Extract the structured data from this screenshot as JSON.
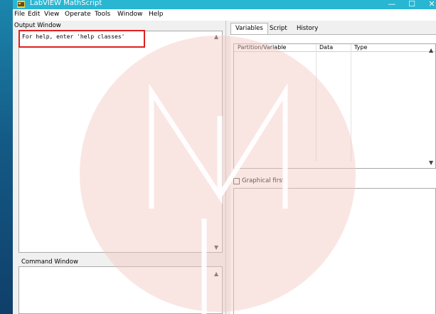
{
  "window": {
    "title": "LabVIEW MathScript"
  },
  "window_controls": {
    "minimize": "—",
    "maximize": "☐",
    "close": "✕"
  },
  "menu": [
    "File",
    "Edit",
    "View",
    "Operate",
    "Tools",
    "Window",
    "Help"
  ],
  "output_window": {
    "label": "Output Window",
    "text": "For help, enter 'help classes'"
  },
  "command_window": {
    "label": "Command Window",
    "text": ""
  },
  "tabs": [
    {
      "label": "Variables",
      "active": true
    },
    {
      "label": "Script",
      "active": false
    },
    {
      "label": "History",
      "active": false
    }
  ],
  "variables_table": {
    "columns": [
      "Partition/Variable",
      "Data",
      "Type"
    ],
    "rows": []
  },
  "graphical_first": {
    "label": "Graphical first",
    "checked": false
  },
  "colors": {
    "titlebar": "#29b6d2",
    "highlight": "#e02020",
    "watermark": "#f2c7c2"
  }
}
